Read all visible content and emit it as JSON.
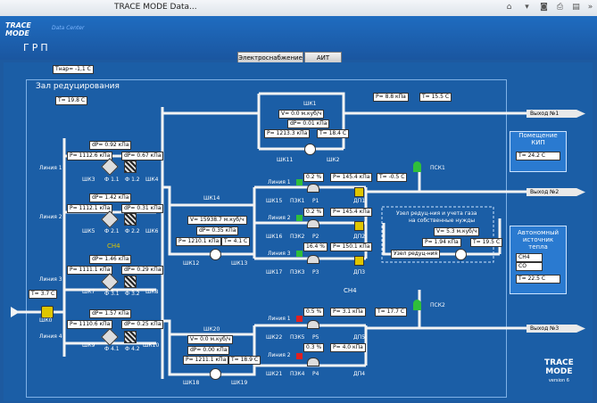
{
  "window": {
    "title": "TRACE MODE Data..."
  },
  "header": {
    "logo": "TRACE MODE",
    "logo_sub": "Data Center",
    "page_title": "ГРП"
  },
  "tabs": [
    {
      "label": "Электроснабжение"
    },
    {
      "label": "АИТ"
    }
  ],
  "outdoor_temp": "Тнар= -1,1 С",
  "zone": {
    "title": "Зал редуцирования",
    "temp": "T= 19.8 C"
  },
  "inlet": {
    "temp": "T= 3.7 C",
    "valve": "ШК0"
  },
  "lines": [
    {
      "label": "Линия 1",
      "dp": "dP= 0.92 кПа",
      "p": "P= 1112.6 кПа",
      "dp2": "dP= 0.67 кПа",
      "valves": [
        "ШК3",
        "Ф 1.1",
        "Ф 1.2",
        "ШК4"
      ]
    },
    {
      "label": "Линия 2",
      "dp": "dP= 1.42 кПа",
      "p": "P= 1112.1 кПа",
      "dp2": "dP= 0.31 кПа",
      "valves": [
        "ШК5",
        "Ф 2.1",
        "Ф 2.2",
        "ШК6"
      ]
    },
    {
      "label": "Линия 3",
      "dp": "dP= 1.46 кПа",
      "p": "P= 1111.1 кПа",
      "dp2": "dP= 0.29 кПа",
      "valves": [
        "ШК7",
        "Ф 3.1",
        "Ф 3.2",
        "ШК8"
      ]
    },
    {
      "label": "Линия 4",
      "dp": "dP= 1.57 кПа",
      "p": "P= 1110.6 кПа",
      "dp2": "dP= 0.25 кПа",
      "valves": [
        "ШК9",
        "Ф 4.1",
        "Ф 4.2",
        "ШК10"
      ]
    }
  ],
  "ch4_label": "CH4",
  "meter_top": {
    "v": "V=",
    "v_val": "0.0",
    "v_unit": "м.куб/ч",
    "dp": "dP= 0.01 кПа",
    "p": "P= 1213.3 кПа",
    "t": "T= 18.4 C",
    "valves": [
      "ШК1",
      "ШК11",
      "ШК2"
    ]
  },
  "meter_top_right": {
    "p": "P=",
    "p_val": "8.8",
    "p_unit": "кПа",
    "t": "T= 15.5 C"
  },
  "meter_mid": {
    "v": "V= 15938.7 м.куб/ч",
    "dp": "dP= 0.35 кПа",
    "p": "P= 1210.1 кПа",
    "t": "T= 4.1 C",
    "valves": [
      "ШК14",
      "ШК12",
      "ШК13"
    ]
  },
  "meter_bot": {
    "v": "V=",
    "v_val": "0.0",
    "v_unit": "м.куб/ч",
    "dp": "dP= 0.00 кПа",
    "p": "P= 1211.1 кПа",
    "t": "T= 18.9 C",
    "valves": [
      "ШК20",
      "ШК18",
      "ШК19"
    ]
  },
  "reg_lines": [
    {
      "label": "Линия 1",
      "pct": "0.2 %",
      "p": "P= 145.4 кПа",
      "t": "T= -0.5 C",
      "valves": [
        "ШК15",
        "ПЗК1",
        "Р1",
        "ДП1"
      ]
    },
    {
      "label": "Линия 2",
      "pct": "0.2 %",
      "p": "P= 145.4 кПа",
      "valves": [
        "ШК16",
        "ПЗК2",
        "Р2",
        "ДП2"
      ]
    },
    {
      "label": "Линия 3",
      "pct": "16.4 %",
      "p": "P= 150.1 кПа",
      "valves": [
        "ШК17",
        "ПЗК3",
        "Р3",
        "ДП3"
      ]
    }
  ],
  "reg_lines_low": [
    {
      "label": "Линия 1",
      "pct": "0.5 %",
      "p": "P=",
      "p_val": "3.1",
      "p_unit": "кПа",
      "t": "T= 17.7 C",
      "valves": [
        "ШК22",
        "ПЗК5",
        "Р5",
        "ДП5"
      ]
    },
    {
      "label": "Линия 2",
      "pct": "0.3 %",
      "p": "P=",
      "p_val": "4.0",
      "p_unit": "кПа",
      "valves": [
        "ШК21",
        "ПЗК4",
        "Р4",
        "ДП4"
      ]
    }
  ],
  "psk": [
    "ПСК1",
    "ПСК2"
  ],
  "exits": [
    "Выход №1",
    "Выход №2",
    "Выход №2",
    "Выход №3"
  ],
  "own_needs": {
    "title_1": "Узел редуц-ния и учета газа",
    "title_2": "на собственные нужды",
    "v": "V=",
    "v_val": "5.3",
    "v_unit": "м.куб/ч",
    "p": "P= 1.94 кПа",
    "t": "T= 19.5 C",
    "node": "Узел редуц-ния"
  },
  "kip_room": {
    "title_1": "Помещение",
    "title_2": "КИП",
    "t": "T= 24.2 C"
  },
  "boiler": {
    "title_1": "Автономный",
    "title_2": "источник",
    "title_3": "тепла",
    "gas1": "CH4",
    "gas2": "CO",
    "t": "T= 22.5 C"
  },
  "ch4_label_2": "CH4",
  "brand": {
    "line1": "TRACE",
    "line2": "MODE",
    "line3": "version 6"
  },
  "colors": {
    "background": "#1b5ea6",
    "panel": "#2a7ad0",
    "pipe": "#f3f3f3",
    "valve_green": "#2fbf3a",
    "valve_yellow": "#e0c600",
    "valve_red": "#e02020"
  }
}
